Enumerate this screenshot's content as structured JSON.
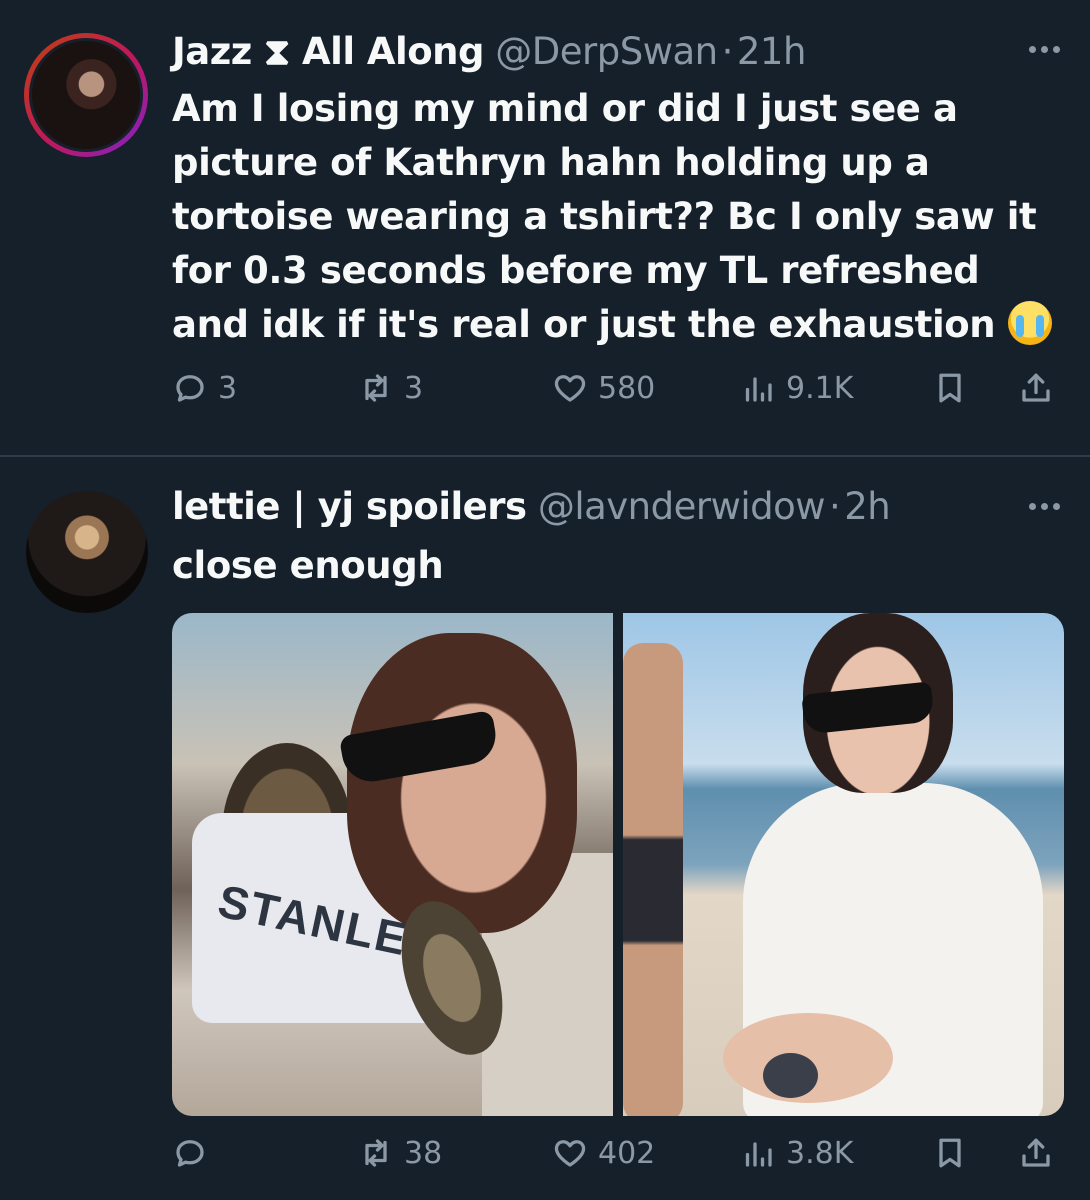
{
  "tweets": [
    {
      "display_name": "Jazz ⧗ All Along",
      "handle": "@DerpSwan",
      "time": "21h",
      "text": "Am I losing my mind or did I just see a picture of Kathryn hahn holding up a tortoise wearing a tshirt?? Bc I only saw it for 0.3 seconds before my TL refreshed and idk if it's real or just the exhaustion",
      "emoji": "loudly-crying-face",
      "stats": {
        "replies": "3",
        "reposts": "3",
        "likes": "580",
        "views": "9.1K"
      }
    },
    {
      "display_name": "lettie | yj spoilers",
      "handle": "@lavnderwidow",
      "time": "2h",
      "text": "close enough",
      "media": {
        "photo_1_shirt_text": "STANLE"
      },
      "stats": {
        "replies": "",
        "reposts": "38",
        "likes": "402",
        "views": "3.8K"
      }
    }
  ],
  "colors": {
    "background": "#15202b",
    "text": "#f7f9f9",
    "secondary": "#8b98a5",
    "divider": "#2f3b47"
  }
}
